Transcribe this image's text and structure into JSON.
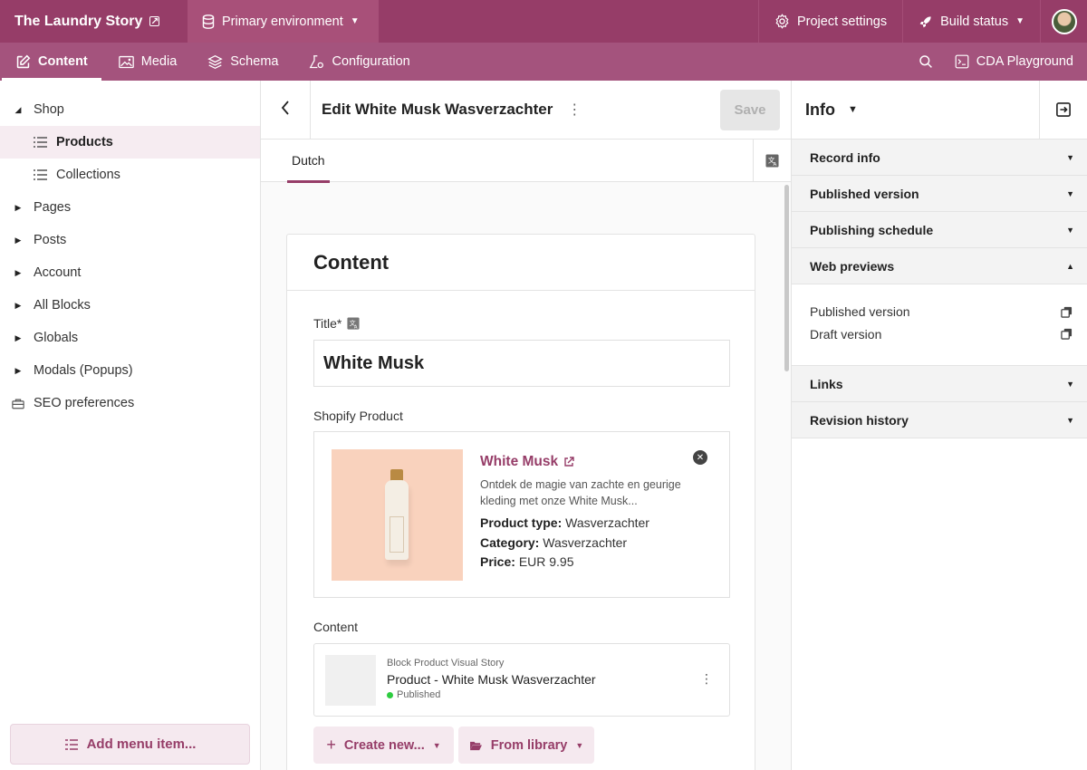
{
  "app": {
    "title": "The Laundry Story",
    "environment": "Primary environment",
    "project_settings": "Project settings",
    "build_status": "Build status"
  },
  "nav": {
    "content": "Content",
    "media": "Media",
    "schema": "Schema",
    "configuration": "Configuration",
    "cda_playground": "CDA Playground"
  },
  "sidebar": {
    "items": [
      {
        "label": "Shop",
        "expanded": true
      },
      {
        "label": "Products",
        "selected": true
      },
      {
        "label": "Collections"
      },
      {
        "label": "Pages"
      },
      {
        "label": "Posts"
      },
      {
        "label": "Account"
      },
      {
        "label": "All Blocks"
      },
      {
        "label": "Globals"
      },
      {
        "label": "Modals (Popups)"
      },
      {
        "label": "SEO preferences"
      }
    ],
    "add_menu_item": "Add menu item..."
  },
  "editor": {
    "heading": "Edit White Musk Wasverzachter",
    "save_label": "Save",
    "locale_tab": "Dutch",
    "section_title": "Content",
    "title_label": "Title*",
    "title_value": "White Musk",
    "shopify_label": "Shopify Product",
    "product": {
      "name": "White Musk",
      "description": "Ontdek de magie van zachte en geurige kleding met onze White Musk...",
      "type_label": "Product type:",
      "type_value": "Wasverzachter",
      "category_label": "Category:",
      "category_value": "Wasverzachter",
      "price_label": "Price:",
      "price_value": "EUR 9.95"
    },
    "content_label": "Content",
    "block": {
      "type": "Block Product Visual Story",
      "name": "Product - White Musk Wasverzachter",
      "status": "Published"
    },
    "create_new": "Create new...",
    "from_library": "From library"
  },
  "info_panel": {
    "title": "Info",
    "sections_top": [
      "Record info",
      "Published version",
      "Publishing schedule"
    ],
    "web_previews": "Web previews",
    "previews": [
      "Published version",
      "Draft version"
    ],
    "sections_bottom": [
      "Links",
      "Revision history"
    ]
  },
  "colors": {
    "brand": "#963d68",
    "nav": "#a4537d",
    "published": "#2ecc40"
  }
}
